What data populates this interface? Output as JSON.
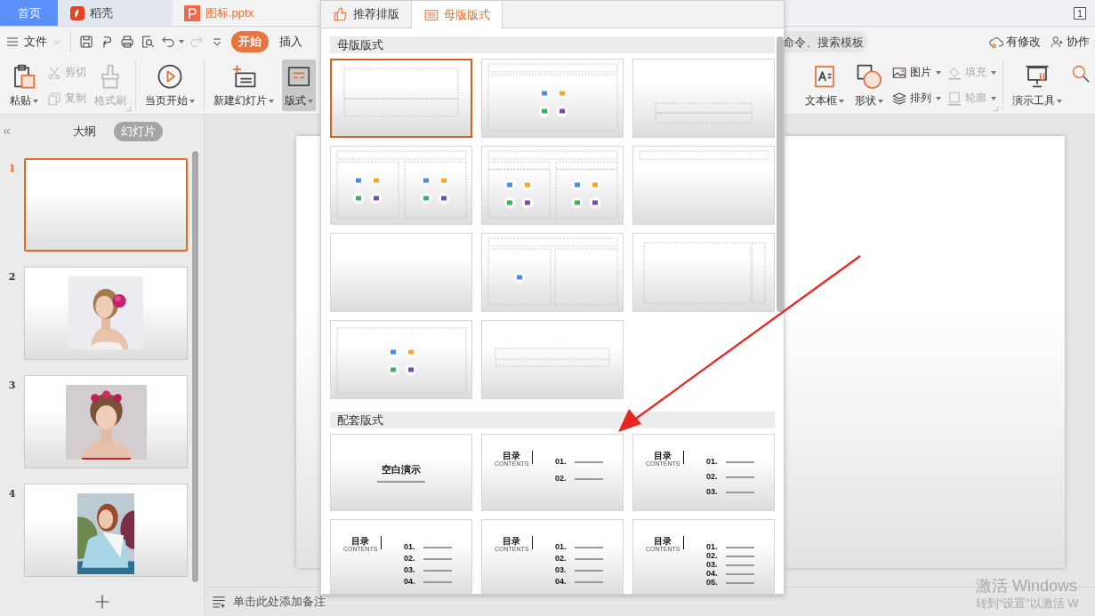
{
  "title_tabs": [
    {
      "label": "首页",
      "kind": "home",
      "selected": false
    },
    {
      "label": "稻壳",
      "kind": "docer",
      "selected": false
    },
    {
      "label": "图标.pptx",
      "kind": "document",
      "selected": true
    }
  ],
  "window_count": "1",
  "menu": {
    "file": "文件",
    "quick_access": [
      {
        "dropdown": false,
        "disabled": false
      },
      {
        "dropdown": false,
        "disabled": false
      },
      {
        "dropdown": false,
        "disabled": false
      },
      {
        "dropdown": false,
        "disabled": false
      },
      {
        "dropdown": true,
        "disabled": false
      },
      {
        "dropdown": false,
        "disabled": true
      },
      {
        "dropdown": false,
        "disabled": false
      }
    ],
    "ribbon_tabs": [
      {
        "label": "开始",
        "selected": true
      },
      {
        "label": "插入",
        "selected": false
      }
    ],
    "search": {
      "placeholder": "命令、搜索模板"
    },
    "status": "有修改",
    "collaborate": "协作"
  },
  "ribbon": {
    "left_groups": [
      [
        {
          "kind": "large",
          "label": "粘贴",
          "dropdown": true,
          "disabled": false,
          "pressed": false
        },
        {
          "kind": "stack",
          "items": [
            {
              "label": "剪切",
              "dropdown": false,
              "disabled": true
            },
            {
              "label": "复制",
              "dropdown": false,
              "disabled": true
            }
          ]
        },
        {
          "kind": "large",
          "label": "格式刷",
          "dropdown": false,
          "disabled": true,
          "pressed": false
        }
      ],
      [
        {
          "kind": "large",
          "label": "当页开始",
          "dropdown": true,
          "disabled": false,
          "pressed": false
        }
      ],
      [
        {
          "kind": "large",
          "label": "新建幻灯片",
          "dropdown": true,
          "disabled": false,
          "pressed": false
        },
        {
          "kind": "large",
          "label": "版式",
          "dropdown": true,
          "disabled": false,
          "pressed": true
        }
      ]
    ],
    "right_groups": [
      [
        {
          "kind": "large",
          "label": "文本框",
          "dropdown": true,
          "disabled": false,
          "pressed": false
        },
        {
          "kind": "large",
          "label": "形状",
          "dropdown": true,
          "disabled": false,
          "pressed": false
        },
        {
          "kind": "stack",
          "items": [
            {
              "label": "图片",
              "dropdown": true,
              "disabled": false
            },
            {
              "label": "排列",
              "dropdown": true,
              "disabled": false
            }
          ]
        },
        {
          "kind": "stack",
          "items": [
            {
              "label": "填充",
              "dropdown": true,
              "disabled": true
            },
            {
              "label": "轮廓",
              "dropdown": true,
              "disabled": true
            }
          ]
        }
      ],
      [
        {
          "kind": "large",
          "label": "演示工具",
          "dropdown": true,
          "disabled": false,
          "pressed": false
        },
        {
          "kind": "icon"
        }
      ]
    ]
  },
  "side_pane": {
    "views": [
      {
        "label": "大纲",
        "selected": false
      },
      {
        "label": "幻灯片",
        "selected": true
      }
    ],
    "slides": [
      {
        "number": "1",
        "kind": "blank",
        "selected": true
      },
      {
        "number": "2",
        "kind": "picture",
        "selected": false
      },
      {
        "number": "3",
        "kind": "picture",
        "selected": false
      },
      {
        "number": "4",
        "kind": "picture",
        "selected": false
      }
    ]
  },
  "notes": {
    "placeholder": "单击此处添加备注"
  },
  "layout_panel": {
    "tabs": [
      {
        "label": "推荐排版",
        "selected": false
      },
      {
        "label": "母版版式",
        "selected": true
      }
    ],
    "master_section": {
      "title": "母版版式",
      "layouts": [
        {
          "kind": "title",
          "selected": true
        },
        {
          "kind": "title-content",
          "selected": false
        },
        {
          "kind": "section",
          "selected": false
        },
        {
          "kind": "two-content",
          "selected": false
        },
        {
          "kind": "comparison",
          "selected": false
        },
        {
          "kind": "title-only",
          "selected": false
        },
        {
          "kind": "blank",
          "selected": false
        },
        {
          "kind": "content-caption",
          "selected": false
        },
        {
          "kind": "vertical",
          "selected": false
        },
        {
          "kind": "content-only",
          "selected": false
        },
        {
          "kind": "text-only",
          "selected": false
        }
      ]
    },
    "template_section": {
      "title": "配套版式",
      "templates": [
        {
          "kind": "cover",
          "title": "空白演示"
        },
        {
          "kind": "contents",
          "title": "目录",
          "subtitle": "CONTENTS",
          "items": [
            "01.",
            "02."
          ]
        },
        {
          "kind": "contents",
          "title": "目录",
          "subtitle": "CONTENTS",
          "items": [
            "01.",
            "02.",
            "03."
          ]
        },
        {
          "kind": "contents",
          "title": "目录",
          "subtitle": "CONTENTS",
          "items": [
            "01.",
            "02.",
            "03.",
            "04."
          ]
        },
        {
          "kind": "contents",
          "title": "目录",
          "subtitle": "CONTENTS",
          "items": [
            "01.",
            "02.",
            "03.",
            "04."
          ]
        },
        {
          "kind": "contents",
          "title": "目录",
          "subtitle": "CONTENTS",
          "items": [
            "01.",
            "02.",
            "03.",
            "04.",
            "05."
          ]
        }
      ]
    }
  },
  "activation": {
    "title": "激活 Windows",
    "text": "转到“设置”以激活 W"
  }
}
